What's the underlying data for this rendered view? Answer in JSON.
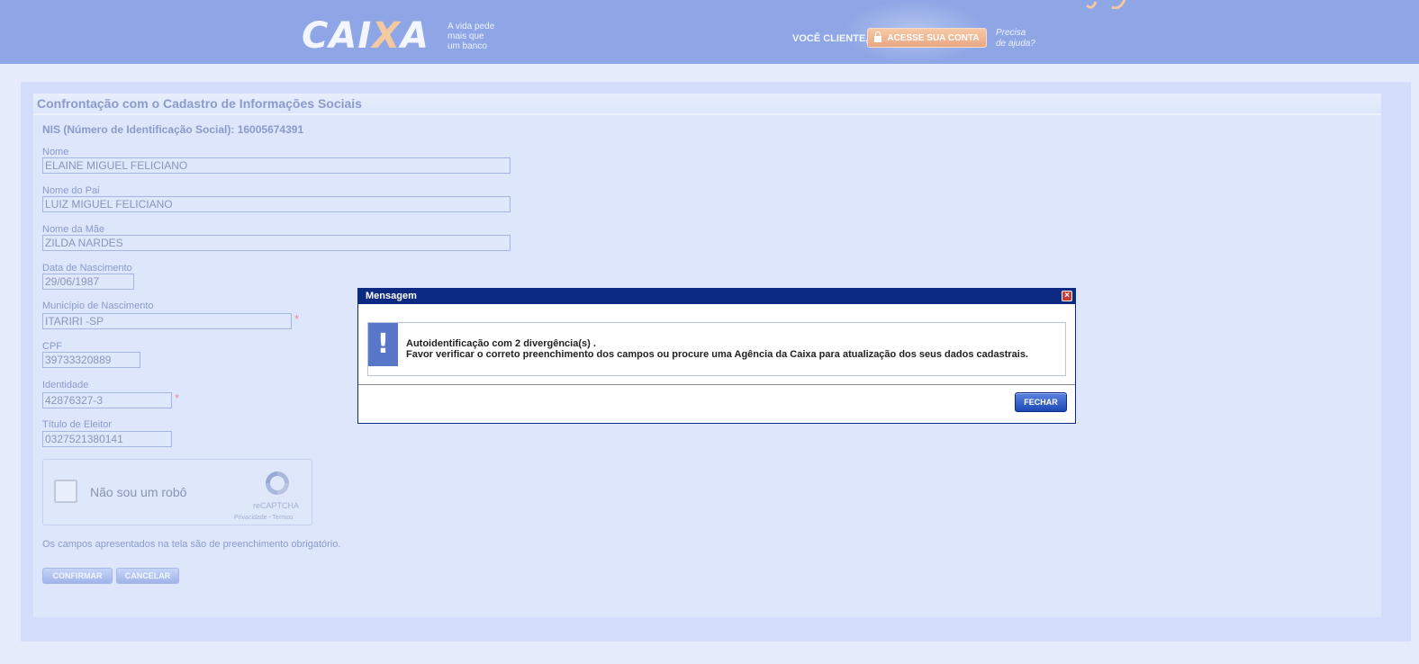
{
  "header": {
    "logo_main": "CAI",
    "logo_x": "X",
    "logo_end": "A",
    "tagline": [
      "A vida pede",
      "mais que",
      "um banco"
    ],
    "voce_cliente": "VOCÊ CLIENTE,",
    "acesse_label": "ACESSE SUA CONTA",
    "ajuda": [
      "Precisa",
      "de ajuda?"
    ]
  },
  "panel": {
    "title": "Confrontação com o Cadastro de Informações Sociais",
    "nis": "NIS (Número de Identificação Social): 16005674391"
  },
  "form": {
    "nome_label": "Nome",
    "nome_value": "ELAINE MIGUEL FELICIANO",
    "pai_label": "Nome do Pai",
    "pai_value": "LUIZ MIGUEL FELICIANO",
    "mae_label": "Nome da Mãe",
    "mae_value": "ZILDA NARDES",
    "nasc_label": "Data de Nascimento",
    "nasc_value": "29/06/1987",
    "mun_label": "Município de Nascimento",
    "mun_value": "ITARIRI -SP",
    "cpf_label": "CPF",
    "cpf_value": "39733320889",
    "ident_label": "Identidade",
    "ident_value": "42876327-3",
    "titulo_label": "Título de Eleitor",
    "titulo_value": "0327521380141",
    "required_mark": "*"
  },
  "captcha": {
    "label": "Não sou um robô",
    "brand": "reCAPTCHA",
    "links": "Privacidade - Termos"
  },
  "note": "Os campos apresentados na tela são de preenchimento obrigatório.",
  "buttons": {
    "confirmar": "CONFIRMAR",
    "cancelar": "CANCELAR"
  },
  "modal": {
    "title": "Mensagem",
    "close": "×",
    "icon": "!",
    "line1": "Autoidentificação com 2 divergência(s) .",
    "line2": "Favor verificar o correto preenchimento dos campos ou procure uma Agência da Caixa para atualização dos seus dados cadastrais.",
    "fechar": "FECHAR"
  }
}
